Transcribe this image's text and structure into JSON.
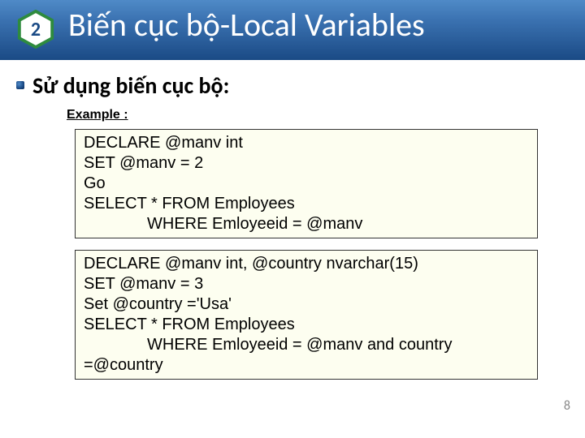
{
  "header": {
    "number": "2",
    "title": "Biến cục bộ-Local Variables"
  },
  "body": {
    "bullet": "Sử dụng biến cục bộ:",
    "example_label": "Example :",
    "code1": {
      "l1": "DECLARE @manv int",
      "l2": "SET @manv = 2",
      "l3": "Go",
      "l4": "SELECT * FROM Employees",
      "l5": "WHERE Emloyeeid = @manv"
    },
    "code2": {
      "l1": "DECLARE @manv int, @country nvarchar(15)",
      "l2": "SET @manv = 3",
      "l3": "Set @country ='Usa'",
      "l4": "SELECT * FROM Employees",
      "l5": "WHERE Emloyeeid = @manv and country",
      "l6": "=@country"
    }
  },
  "page_number": "8"
}
